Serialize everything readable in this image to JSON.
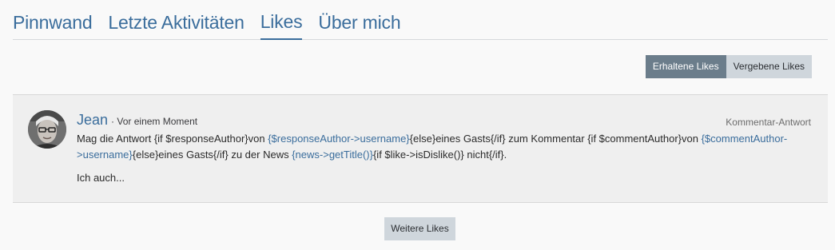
{
  "tabs": [
    {
      "label": "Pinnwand"
    },
    {
      "label": "Letzte Aktivitäten"
    },
    {
      "label": "Likes"
    },
    {
      "label": "Über mich"
    }
  ],
  "active_tab": "Likes",
  "toggle": {
    "received": "Erhaltene Likes",
    "given": "Vergebene Likes"
  },
  "like": {
    "user": "Jean",
    "time": "· Vor einem Moment",
    "type": "Kommentar-Antwort",
    "message": {
      "p1": "Mag die Antwort {if $responseAuthor}von ",
      "l1": "{$responseAuthor->username}",
      "p2": "{else}eines Gasts{/if} zum Kommentar {if $commentAuthor}von ",
      "l2": "{$commentAuthor->username}",
      "p3": "{else}eines Gasts{/if} zu der News ",
      "l3": "{news->getTitle()}",
      "p4": "{if $like->isDislike()} nicht{/if}."
    },
    "quote": "Ich auch..."
  },
  "more_button": "Weitere Likes",
  "colors": {
    "link": "#3a6d9c",
    "button_active": "#6b7d8b",
    "button_inactive": "#cfd6dc"
  }
}
